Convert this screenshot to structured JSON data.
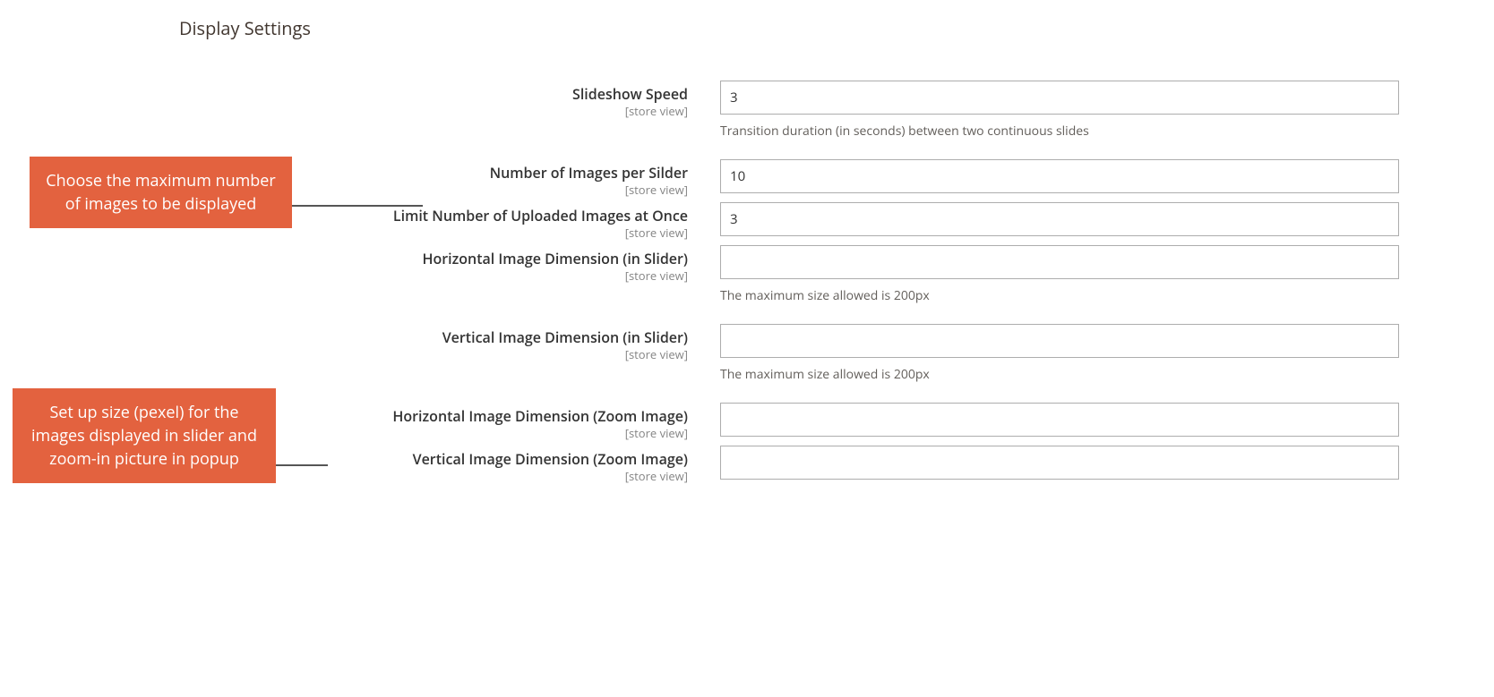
{
  "section_title": "Display Settings",
  "scope_text": "[store view]",
  "fields": {
    "slideshow_speed": {
      "label": "Slideshow Speed",
      "value": "3",
      "note": "Transition duration (in seconds) between two continuous slides"
    },
    "images_per_slider": {
      "label": "Number of Images per Silder",
      "value": "10"
    },
    "upload_limit": {
      "label": "Limit Number of Uploaded Images at Once",
      "value": "3"
    },
    "h_dim_slider": {
      "label": "Horizontal Image Dimension (in Slider)",
      "value": "",
      "note": "The maximum size allowed is 200px"
    },
    "v_dim_slider": {
      "label": "Vertical Image Dimension (in Slider)",
      "value": "",
      "note": "The maximum size allowed is 200px"
    },
    "h_dim_zoom": {
      "label": "Horizontal Image Dimension (Zoom Image)",
      "value": ""
    },
    "v_dim_zoom": {
      "label": "Vertical Image Dimension (Zoom Image)",
      "value": ""
    }
  },
  "callouts": {
    "c1": "Choose the maximum number of images to be displayed",
    "c2": "Set up size (pexel) for the images displayed in slider and zoom-in picture in popup"
  }
}
